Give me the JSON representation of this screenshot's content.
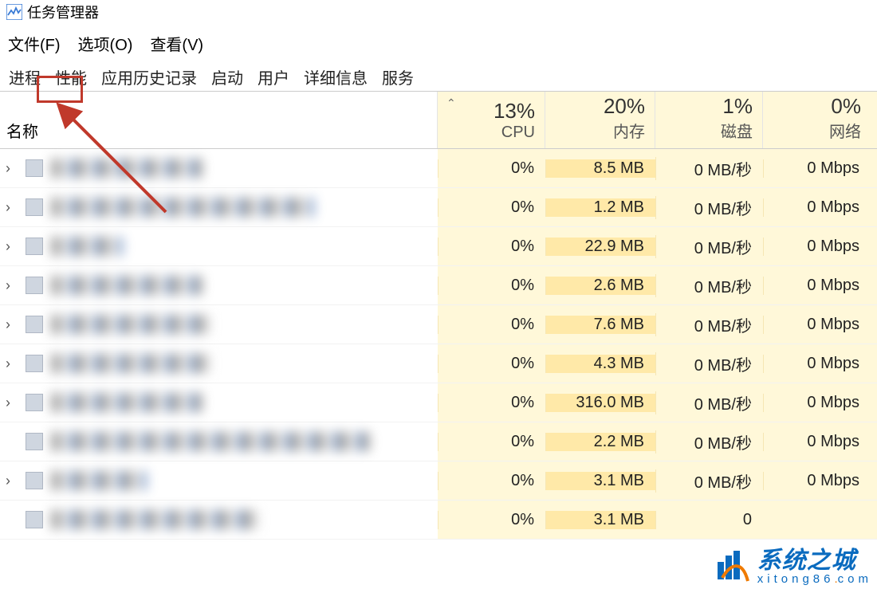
{
  "window": {
    "title": "任务管理器"
  },
  "menu": {
    "file": "文件(F)",
    "options": "选项(O)",
    "view": "查看(V)"
  },
  "tabs": {
    "processes": "进程",
    "performance": "性能",
    "app_history": "应用历史记录",
    "startup": "启动",
    "users": "用户",
    "details": "详细信息",
    "services": "服务"
  },
  "headers": {
    "name": "名称",
    "cpu": {
      "pct": "13%",
      "label": "CPU"
    },
    "mem": {
      "pct": "20%",
      "label": "内存"
    },
    "disk": {
      "pct": "1%",
      "label": "磁盘"
    },
    "net": {
      "pct": "0%",
      "label": "网络"
    }
  },
  "rows": [
    {
      "expandable": true,
      "cpu": "0%",
      "mem": "8.5 MB",
      "disk": "0 MB/秒",
      "net": "0 Mbps"
    },
    {
      "expandable": true,
      "cpu": "0%",
      "mem": "1.2 MB",
      "disk": "0 MB/秒",
      "net": "0 Mbps"
    },
    {
      "expandable": true,
      "cpu": "0%",
      "mem": "22.9 MB",
      "disk": "0 MB/秒",
      "net": "0 Mbps"
    },
    {
      "expandable": true,
      "cpu": "0%",
      "mem": "2.6 MB",
      "disk": "0 MB/秒",
      "net": "0 Mbps"
    },
    {
      "expandable": true,
      "cpu": "0%",
      "mem": "7.6 MB",
      "disk": "0 MB/秒",
      "net": "0 Mbps"
    },
    {
      "expandable": true,
      "cpu": "0%",
      "mem": "4.3 MB",
      "disk": "0 MB/秒",
      "net": "0 Mbps"
    },
    {
      "expandable": true,
      "cpu": "0%",
      "mem": "316.0 MB",
      "disk": "0 MB/秒",
      "net": "0 Mbps"
    },
    {
      "expandable": false,
      "cpu": "0%",
      "mem": "2.2 MB",
      "disk": "0 MB/秒",
      "net": "0 Mbps"
    },
    {
      "expandable": true,
      "cpu": "0%",
      "mem": "3.1 MB",
      "disk": "0 MB/秒",
      "net": "0 Mbps"
    },
    {
      "expandable": false,
      "cpu": "0%",
      "mem": "3.1 MB",
      "disk": "0",
      "net": ""
    }
  ],
  "watermark": {
    "main": "系统之城",
    "sub_left": "xitong86",
    "sub_dot": ".",
    "sub_right": "com"
  }
}
